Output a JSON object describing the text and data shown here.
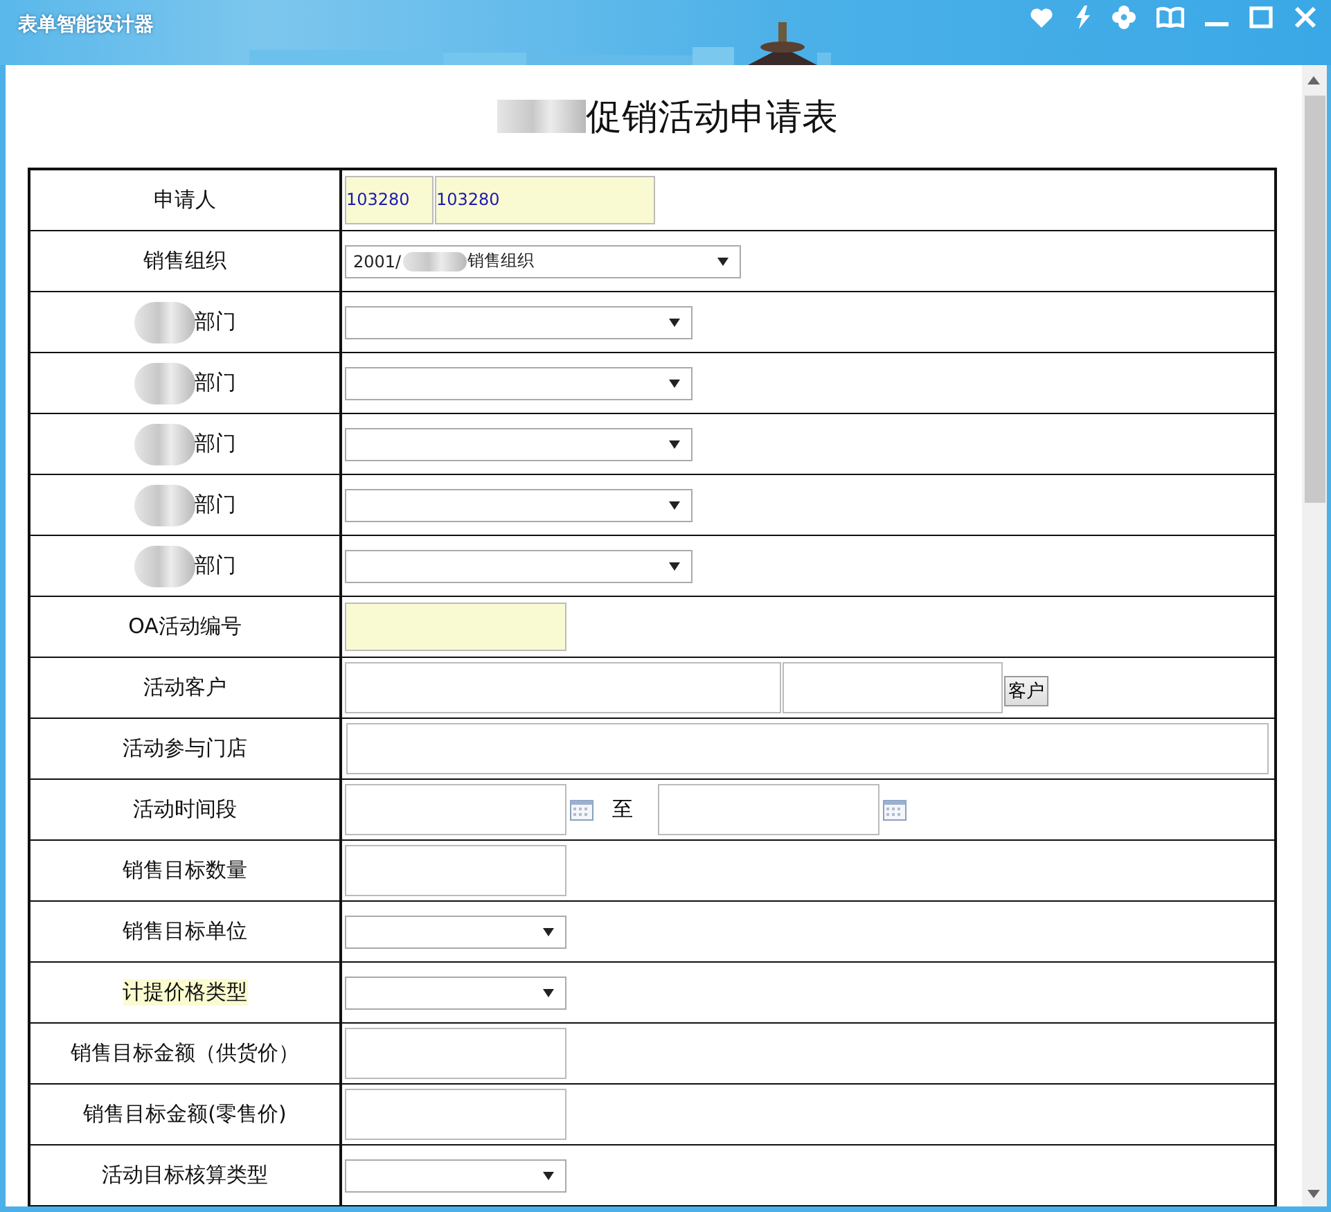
{
  "window": {
    "title": "表单智能设计器"
  },
  "form": {
    "title": "促销活动申请表",
    "title_redacted": true
  },
  "rows": [
    {
      "label": "申请人",
      "kind": "applicant",
      "values": [
        "103280",
        "103280"
      ]
    },
    {
      "label": "销售组织",
      "kind": "select-long",
      "value": "2001/",
      "value_tail": "销售组织"
    },
    {
      "label": "部门",
      "kind": "select-mid",
      "redacted": true
    },
    {
      "label": "部门",
      "kind": "select-mid",
      "redacted": true
    },
    {
      "label": "部门",
      "kind": "select-mid",
      "redacted": true
    },
    {
      "label": "部门",
      "kind": "select-mid",
      "redacted": true
    },
    {
      "label": "部门",
      "kind": "select-mid",
      "redacted": true
    },
    {
      "label": "OA活动编号",
      "kind": "input-readonly"
    },
    {
      "label": "活动客户",
      "kind": "customer",
      "button": "客户"
    },
    {
      "label": "活动参与门店",
      "kind": "input-wide"
    },
    {
      "label": "活动时间段",
      "kind": "date-range",
      "separator": "至"
    },
    {
      "label": "销售目标数量",
      "kind": "input-short"
    },
    {
      "label": "销售目标单位",
      "kind": "select-short"
    },
    {
      "label": "计提价格类型",
      "kind": "select-short",
      "highlighted": true
    },
    {
      "label": "销售目标金额（供货价）",
      "kind": "input-short"
    },
    {
      "label": "销售目标金额(零售价)",
      "kind": "input-short"
    },
    {
      "label": "活动目标核算类型",
      "kind": "select-short"
    }
  ]
}
